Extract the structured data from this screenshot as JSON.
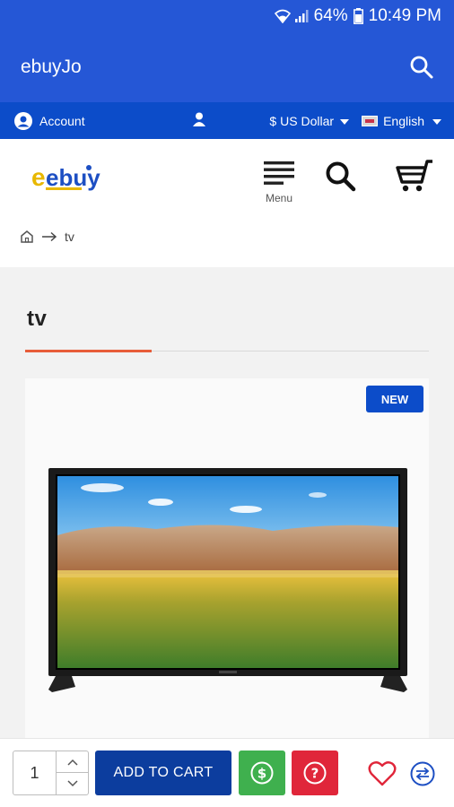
{
  "status_bar": {
    "battery": "64%",
    "time": "10:49 PM"
  },
  "app_bar": {
    "title": "ebuyJo"
  },
  "top_nav": {
    "account_label": "Account",
    "currency_symbol": "$",
    "currency_label": "US Dollar",
    "language_label": "English"
  },
  "header": {
    "logo_text": "ebuy",
    "menu_label": "Menu"
  },
  "breadcrumb": {
    "current": "tv"
  },
  "page": {
    "title": "tv"
  },
  "product": {
    "badge": "NEW",
    "image": "tv-television"
  },
  "action_bar": {
    "quantity": "1",
    "add_to_cart_label": "ADD TO CART"
  },
  "colors": {
    "primary": "#2557d6",
    "nav": "#0c4cc9",
    "cart_button": "#0c3d9e",
    "accent_rule": "#e85d3a",
    "green": "#3fb04e",
    "red": "#e0263a"
  }
}
